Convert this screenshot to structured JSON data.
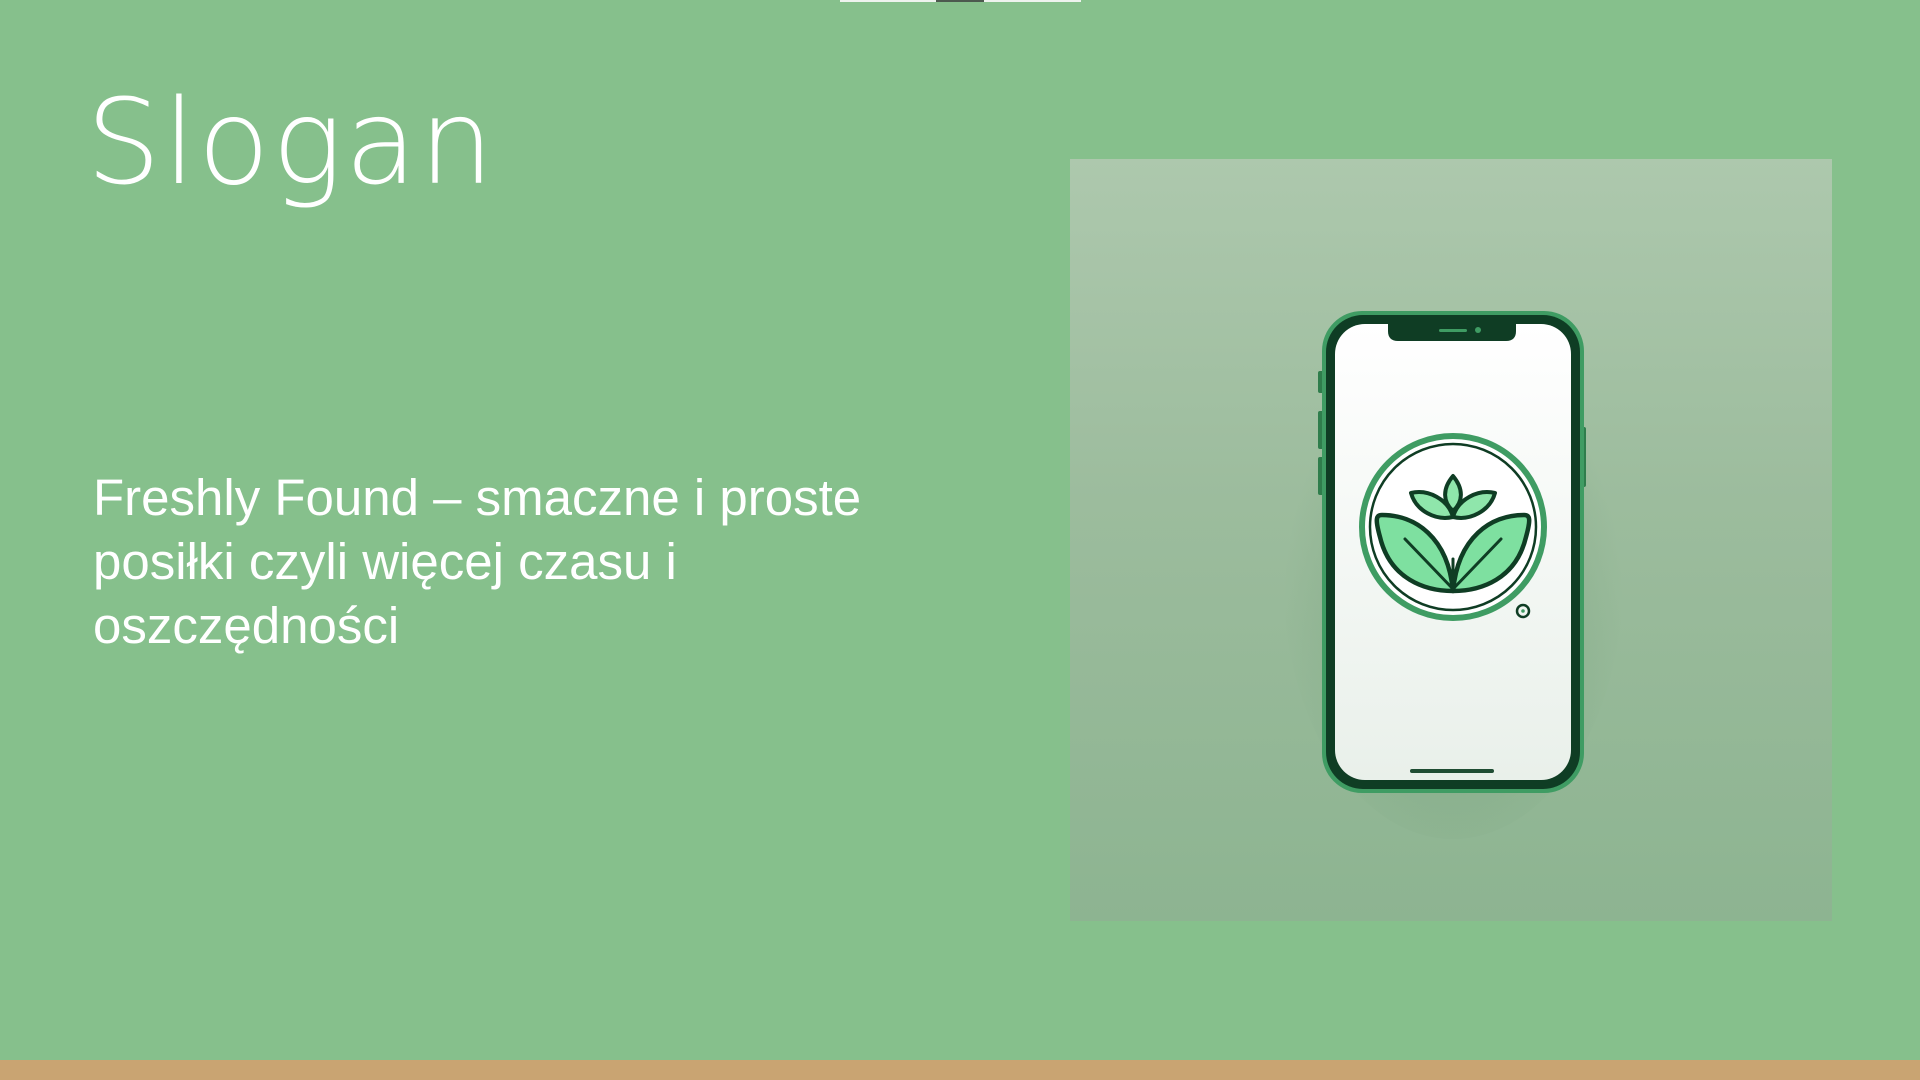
{
  "slide": {
    "title": "Slogan",
    "body": "Freshly Found – smaczne i proste posiłki czyli więcej czasu i oszczędności"
  },
  "image": {
    "subject": "smartphone-with-leaf-logo-illustration",
    "icon": "leaf-logo-icon"
  },
  "colors": {
    "background": "#86c08c",
    "text": "#ffffff",
    "accent_bar": "#c9a472",
    "phone_frame": "#2e8b57",
    "leaf_fill": "#7ee0a0"
  }
}
